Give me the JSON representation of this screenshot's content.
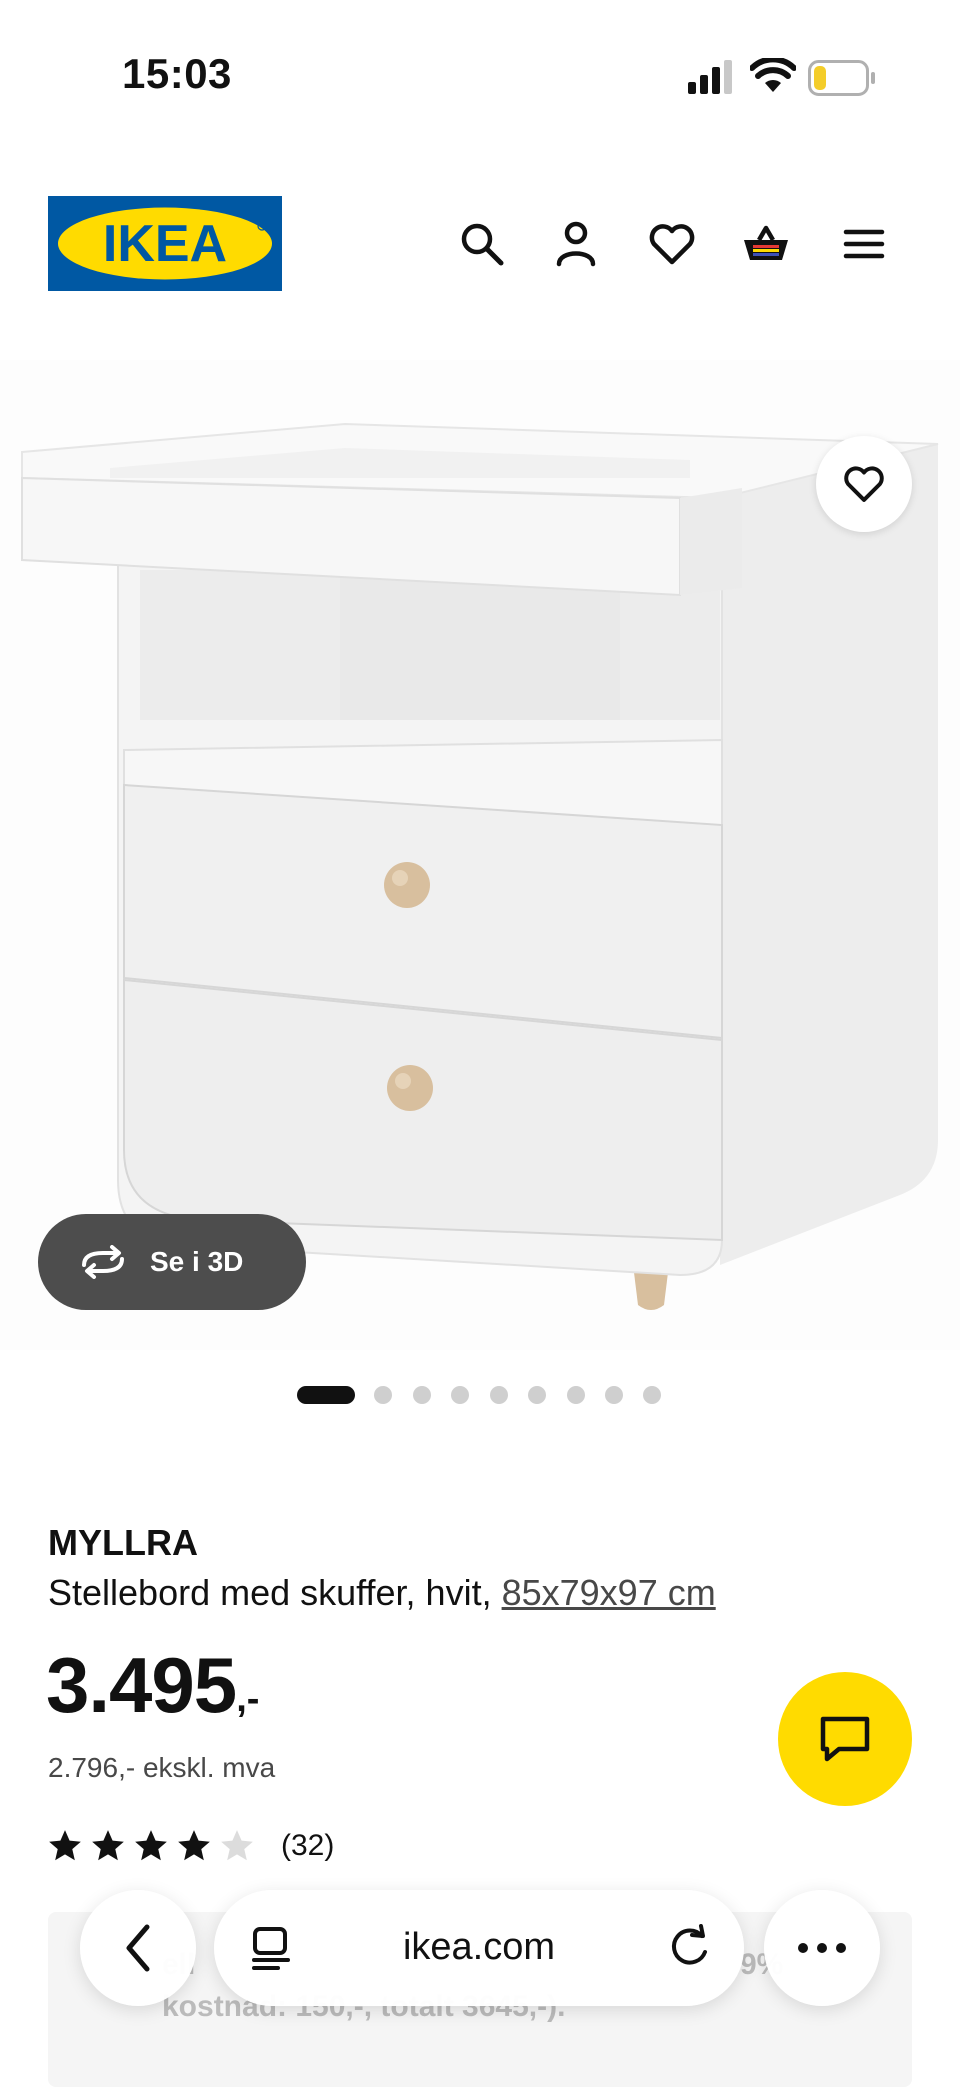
{
  "status_bar": {
    "time": "15:03"
  },
  "header": {
    "logo_text": "IKEA",
    "colors": {
      "brand_blue": "#0058a3",
      "brand_yellow": "#ffdb00"
    },
    "icons": [
      "search-icon",
      "account-icon",
      "heart-icon",
      "basket-icon",
      "menu-icon"
    ]
  },
  "gallery": {
    "view_3d_label": "Se i 3D",
    "image_count": 9,
    "active_index": 0
  },
  "product": {
    "name": "MYLLRA",
    "description": "Stellebord med skuffer, hvit,",
    "dimensions": "85x79x97 cm",
    "price": "3.495",
    "price_suffix": ",-",
    "price_ex_vat": "2.796,- ekskl. mva",
    "rating": {
      "stars": 4,
      "max": 5,
      "count": "(32)"
    }
  },
  "behind_overlay": {
    "line1": "ell",
    "line1_tail": "9%",
    "line2": "kostnad: 150,-, totalt 3645,-)."
  },
  "browser": {
    "url": "ikea.com"
  }
}
